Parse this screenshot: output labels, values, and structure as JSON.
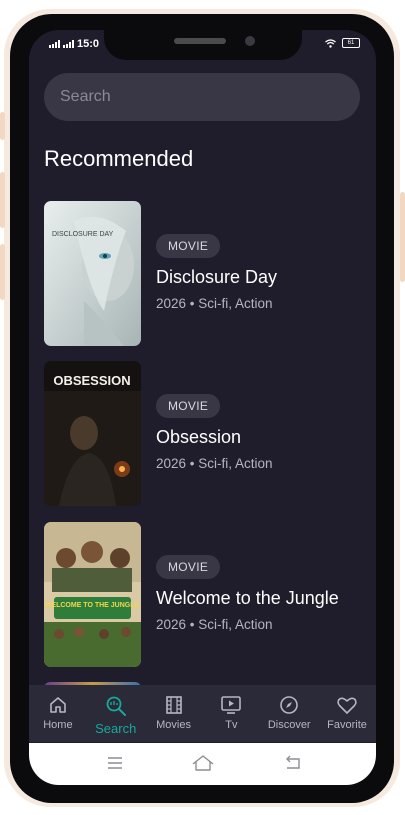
{
  "status": {
    "time": "15:0",
    "battery": "61"
  },
  "search": {
    "placeholder": "Search"
  },
  "section": {
    "title": "Recommended"
  },
  "movies": [
    {
      "tag": "MOVIE",
      "title": "Disclosure Day",
      "meta": "2026 • Sci-fi, Action",
      "poster_text": "DISCLOSURE DAY"
    },
    {
      "tag": "MOVIE",
      "title": "Obsession",
      "meta": "2026 • Sci-fi, Action",
      "poster_text": "OBSESSION"
    },
    {
      "tag": "MOVIE",
      "title": "Welcome to the Jungle",
      "meta": "2026 • Sci-fi, Action",
      "poster_text": "WELCOME TO THE JUNGLE"
    }
  ],
  "nav": [
    {
      "label": "Home",
      "icon": "home-icon",
      "active": false
    },
    {
      "label": "Search",
      "icon": "search-icon",
      "active": true
    },
    {
      "label": "Movies",
      "icon": "film-icon",
      "active": false
    },
    {
      "label": "Tv",
      "icon": "tv-icon",
      "active": false
    },
    {
      "label": "Discover",
      "icon": "compass-icon",
      "active": false
    },
    {
      "label": "Favorite",
      "icon": "heart-icon",
      "active": false
    }
  ],
  "colors": {
    "background": "#1f1d2b",
    "accent": "#18a99c",
    "surface": "#393746"
  }
}
